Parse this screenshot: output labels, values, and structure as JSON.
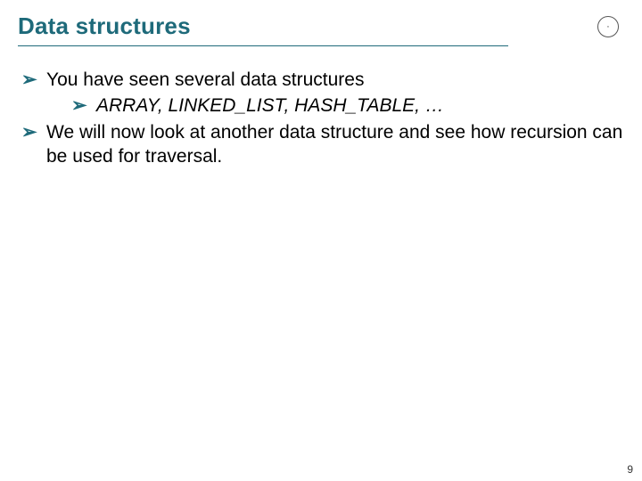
{
  "slide": {
    "title": "Data structures",
    "logo_symbol": "·",
    "bullets": {
      "b1": "You have seen several data structures",
      "b1_sub1": "ARRAY, LINKED_LIST, HASH_TABLE, …",
      "b2": "We will now look at another data structure and see how recursion can be used for traversal."
    },
    "arrow_glyph": "➢",
    "page_number": "9"
  }
}
